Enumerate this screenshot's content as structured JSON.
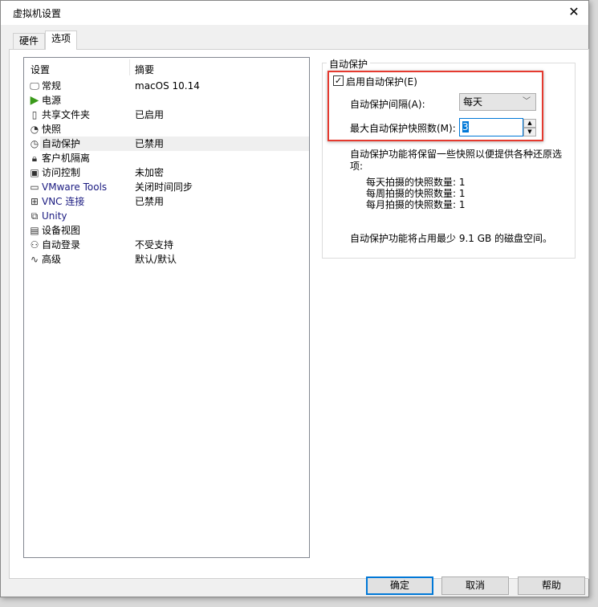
{
  "window": {
    "title": "虚拟机设置",
    "close_icon": "close-icon"
  },
  "tabs": [
    {
      "label": "硬件",
      "selected": false
    },
    {
      "label": "选项",
      "selected": true
    }
  ],
  "list": {
    "headers": [
      "设置",
      "摘要"
    ],
    "items": [
      {
        "name": "常规",
        "summary": "macOS 10.14",
        "icon": "monitor-icon"
      },
      {
        "name": "电源",
        "summary": "",
        "icon": "play-icon"
      },
      {
        "name": "共享文件夹",
        "summary": "已启用",
        "icon": "folder-icon"
      },
      {
        "name": "快照",
        "summary": "",
        "icon": "snapshot-icon"
      },
      {
        "name": "自动保护",
        "summary": "已禁用",
        "icon": "clock-icon",
        "selected": true
      },
      {
        "name": "客户机隔离",
        "summary": "",
        "icon": "lock-icon"
      },
      {
        "name": "访问控制",
        "summary": "未加密",
        "icon": "access-lock-icon"
      },
      {
        "name": "VMware Tools",
        "summary": "关闭时间同步",
        "icon": "vm-icon"
      },
      {
        "name": "VNC 连接",
        "summary": "已禁用",
        "icon": "vnc-icon"
      },
      {
        "name": "Unity",
        "summary": "",
        "icon": "unity-icon"
      },
      {
        "name": "设备视图",
        "summary": "",
        "icon": "device-view-icon"
      },
      {
        "name": "自动登录",
        "summary": "不受支持",
        "icon": "users-icon"
      },
      {
        "name": "高级",
        "summary": "默认/默认",
        "icon": "waveform-icon"
      }
    ]
  },
  "autoprotect": {
    "group_title": "自动保护",
    "enable_label": "启用自动保护(E)",
    "enabled": true,
    "interval_label": "自动保护间隔(A):",
    "interval_value": "每天",
    "max_label": "最大自动保护快照数(M):",
    "max_value": "3",
    "desc_line1": "自动保护功能将保留一些快照以便提供各种还原选",
    "desc_line2": "项:",
    "daily": "每天拍摄的快照数量: 1",
    "weekly": "每周拍摄的快照数量: 1",
    "monthly": "每月拍摄的快照数量: 1",
    "disk": "自动保护功能将占用最少 9.1 GB 的磁盘空间。",
    "highlight_color": "#e53a2f"
  },
  "buttons": {
    "ok": "确定",
    "cancel": "取消",
    "help": "帮助"
  }
}
